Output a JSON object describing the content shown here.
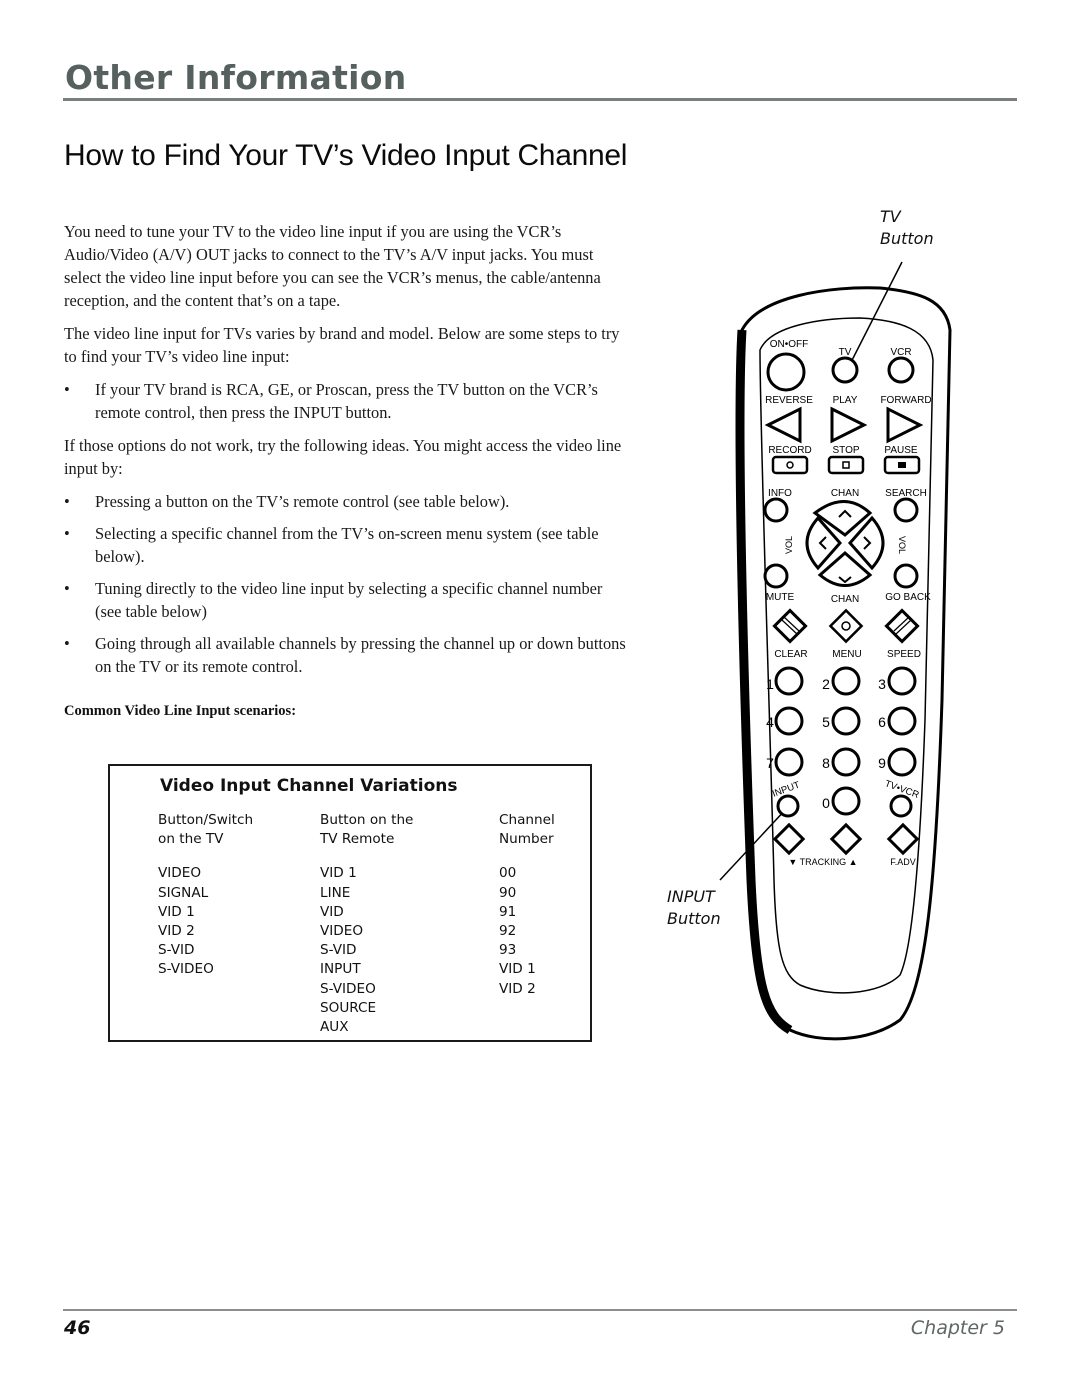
{
  "header": {
    "section": "Other Information",
    "title": "How to Find Your TV’s Video Input Channel"
  },
  "body": {
    "intro_paragraph": "You need to tune your TV to the video line input if you are using the VCR’s Audio/Video (A/V) OUT jacks to connect to the TV’s A/V input jacks. You must select the video line input before you can see the VCR’s menus, the cable/antenna reception, and the content that’s on a tape.",
    "varies_paragraph": "The video line input for TVs varies by brand and model. Below are some steps to try to find your TV’s video line input:",
    "bullets_first": [
      "If your TV brand is RCA, GE, or Proscan, press the TV button on the VCR’s remote control, then press the INPUT button."
    ],
    "fallback_paragraph": "If those options do not work, try the following ideas. You might access the video line input by:",
    "bullets_second": [
      "Pressing a button on the TV’s remote control (see table below).",
      "Selecting a specific channel from the TV’s on-screen menu system (see table below).",
      "Tuning directly to the video line input by selecting a specific channel number (see table below)",
      "Going through all available channels by pressing the channel up or down buttons on the TV or its remote control."
    ],
    "bullet_glyph": "•",
    "subhead": "Common Video Line Input scenarios:"
  },
  "table": {
    "title": "Video Input Channel Variations",
    "columns": [
      {
        "header_line1": "Button/Switch",
        "header_line2": "on the TV",
        "values": [
          "VIDEO",
          "SIGNAL",
          "VID 1",
          "VID 2",
          "S-VID",
          "S-VIDEO"
        ]
      },
      {
        "header_line1": "Button on the",
        "header_line2": "TV Remote",
        "values": [
          "VID 1",
          "LINE",
          "VID",
          "VIDEO",
          "S-VID",
          "INPUT",
          "S-VIDEO",
          "SOURCE",
          "AUX"
        ]
      },
      {
        "header_line1": "Channel",
        "header_line2": "Number",
        "values": [
          "00",
          "90",
          "91",
          "92",
          "93",
          "VID 1",
          "VID 2"
        ]
      }
    ]
  },
  "remote": {
    "callout_tv_line1": "TV",
    "callout_tv_line2": "Button",
    "callout_input_line1": "INPUT",
    "callout_input_line2": "Button",
    "labels": {
      "on_off": "ON•OFF",
      "tv": "TV",
      "vcr": "VCR",
      "reverse": "REVERSE",
      "play": "PLAY",
      "forward": "FORWARD",
      "record": "RECORD",
      "stop": "STOP",
      "pause": "PAUSE",
      "info": "INFO",
      "chan_up": "CHAN",
      "search": "SEARCH",
      "vol_left": "VOL",
      "vol_right": "VOL",
      "mute": "MUTE",
      "chan_down": "CHAN",
      "go_back": "GO BACK",
      "clear": "CLEAR",
      "menu": "MENU",
      "speed": "SPEED",
      "digits": [
        "1",
        "2",
        "3",
        "4",
        "5",
        "6",
        "7",
        "8",
        "9",
        "0"
      ],
      "input": "INPUT",
      "tv_vcr": "TV•VCR",
      "tracking": "▼ TRACKING ▲",
      "f_adv": "F.ADV"
    }
  },
  "footer": {
    "page_number": "46",
    "chapter": "Chapter 5"
  }
}
